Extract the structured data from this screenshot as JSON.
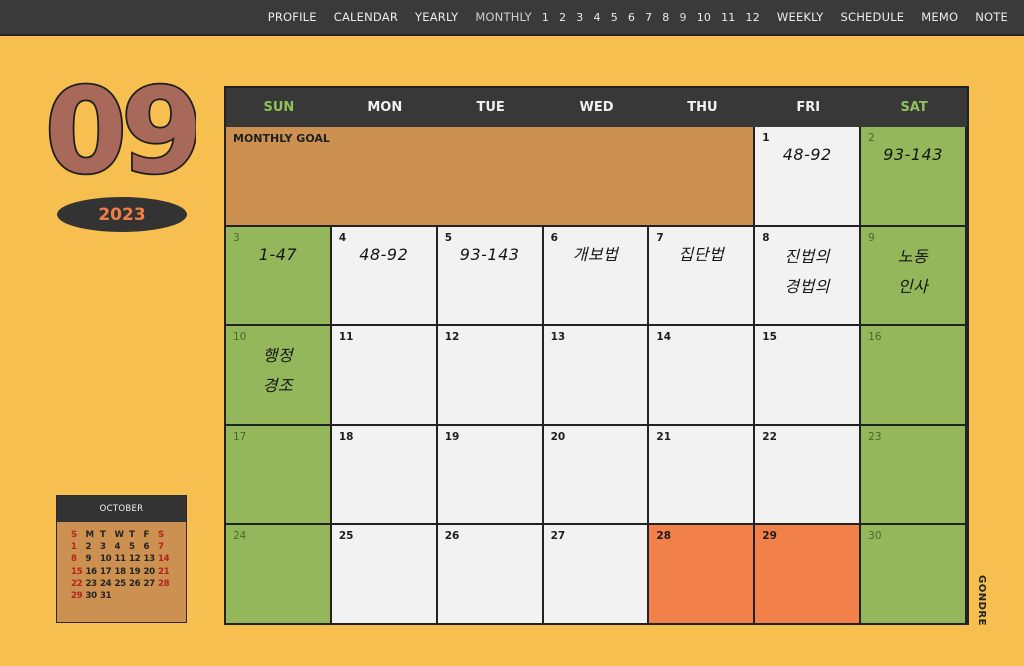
{
  "nav": {
    "profile": "PROFILE",
    "calendar": "CALENDAR",
    "yearly": "YEARLY",
    "monthly": "MONTHLY",
    "months": [
      "1",
      "2",
      "3",
      "4",
      "5",
      "6",
      "7",
      "8",
      "9",
      "10",
      "11",
      "12"
    ],
    "weekly": "WEEKLY",
    "schedule": "SCHEDULE",
    "memo": "MEMO",
    "note": "NOTE"
  },
  "month_number": "09",
  "year": "2023",
  "colors": {
    "background": "#f6bf4f",
    "bar": "#3a3a3a",
    "weekend": "#93b75a",
    "highlight": "#f2804a",
    "goal": "#cc9150",
    "month_number": "#a8685a"
  },
  "weekdays": [
    "SUN",
    "MON",
    "TUE",
    "WED",
    "THU",
    "FRI",
    "SAT"
  ],
  "goal_label": "MONTHLY GOAL",
  "days": [
    {
      "d": "1",
      "note": [
        "48-92"
      ]
    },
    {
      "d": "2",
      "note": [
        "93-143"
      ]
    },
    {
      "d": "3",
      "note": [
        "1-47"
      ]
    },
    {
      "d": "4",
      "note": [
        "48-92"
      ]
    },
    {
      "d": "5",
      "note": [
        "93-143"
      ]
    },
    {
      "d": "6",
      "note": [
        "개보법"
      ]
    },
    {
      "d": "7",
      "note": [
        "집단법"
      ]
    },
    {
      "d": "8",
      "note": [
        "진법의",
        "경법의"
      ]
    },
    {
      "d": "9",
      "note": [
        "노동",
        "인사"
      ]
    },
    {
      "d": "10",
      "note": [
        "행정",
        "경조"
      ]
    },
    {
      "d": "11",
      "note": []
    },
    {
      "d": "12",
      "note": []
    },
    {
      "d": "13",
      "note": []
    },
    {
      "d": "14",
      "note": []
    },
    {
      "d": "15",
      "note": []
    },
    {
      "d": "16",
      "note": []
    },
    {
      "d": "17",
      "note": []
    },
    {
      "d": "18",
      "note": []
    },
    {
      "d": "19",
      "note": []
    },
    {
      "d": "20",
      "note": []
    },
    {
      "d": "21",
      "note": []
    },
    {
      "d": "22",
      "note": []
    },
    {
      "d": "23",
      "note": []
    },
    {
      "d": "24",
      "note": []
    },
    {
      "d": "25",
      "note": []
    },
    {
      "d": "26",
      "note": []
    },
    {
      "d": "27",
      "note": []
    },
    {
      "d": "28",
      "note": []
    },
    {
      "d": "29",
      "note": []
    },
    {
      "d": "30",
      "note": []
    }
  ],
  "mini_calendar": {
    "title": "OCTOBER",
    "weekdays": [
      "S",
      "M",
      "T",
      "W",
      "T",
      "F",
      "S"
    ],
    "dates": [
      "1",
      "2",
      "3",
      "4",
      "5",
      "6",
      "7",
      "8",
      "9",
      "10",
      "11",
      "12",
      "13",
      "14",
      "15",
      "16",
      "17",
      "18",
      "19",
      "20",
      "21",
      "22",
      "23",
      "24",
      "25",
      "26",
      "27",
      "28",
      "29",
      "30",
      "31"
    ]
  },
  "brand": "GONDRE"
}
